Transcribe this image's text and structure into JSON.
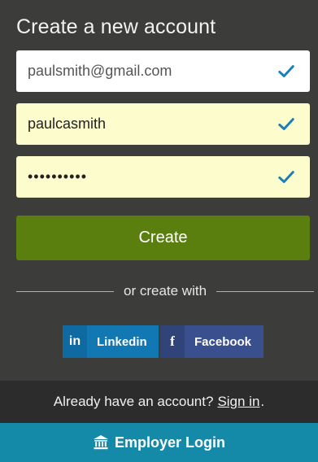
{
  "form": {
    "title": "Create a new account",
    "email_value": "paulsmith@gmail.com",
    "username_value": "paulcasmith",
    "password_mask": "••••••••••",
    "create_label": "Create",
    "divider_text": "or create with"
  },
  "social": {
    "linkedin_icon": "in",
    "linkedin_label": "Linkedin",
    "facebook_icon": "f",
    "facebook_label": "Facebook"
  },
  "footer": {
    "signin_prompt": "Already have an account?",
    "signin_link": "Sign in",
    "signin_period": ".",
    "employer_label": "Employer Login"
  },
  "colors": {
    "panel_bg": "#3c3d3a",
    "field_highlight": "#fdfccc",
    "check_color": "#1a7fb8",
    "create_button": "#5b7f0f",
    "linkedin": "#1178b3",
    "facebook": "#3a4f8e",
    "footer_bar": "#2c2c2c",
    "employer_bar": "#148aa8"
  },
  "icons": {
    "field_check": "checkmark-icon",
    "employer": "bank-building-icon"
  }
}
